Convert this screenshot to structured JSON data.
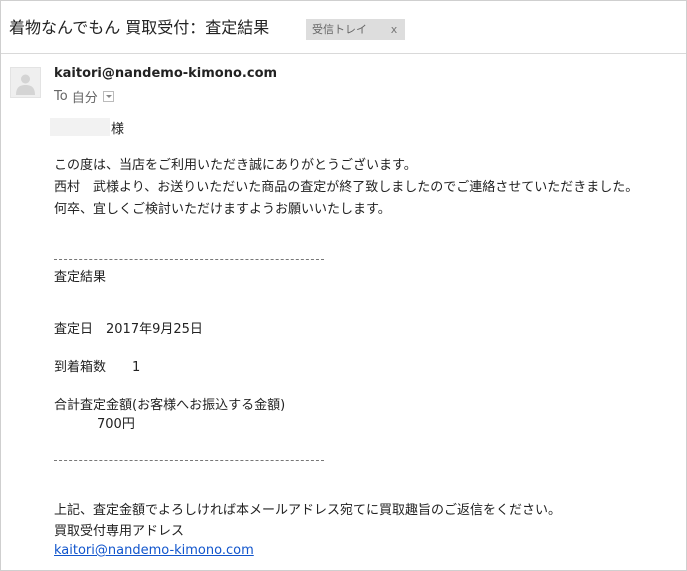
{
  "header": {
    "subject": "着物なんでもん 買取受付：査定結果",
    "label": "受信トレイ",
    "label_close": "x"
  },
  "sender": {
    "email": "kaitori@nandemo-kimono.com",
    "to_label": "To",
    "to_value": "自分"
  },
  "body": {
    "salutation_suffix": "様",
    "para1": [
      "この度は、当店をご利用いただき誠にありがとうございます。",
      "西村　武様より、お送りいただいた商品の査定が終了致しましたのでご連絡させていただきました。",
      "何卒、宜しくご検討いただけますようお願いいたします。"
    ],
    "result_title": "査定結果",
    "date_line": "査定日　2017年9月25日",
    "boxes_line": "到着箱数　　1",
    "total_label": "合計査定金額(お客様へお振込する金額)",
    "total_value": "700円",
    "closing1": "上記、査定金額でよろしければ本メールアドレス宛てに買取趣旨のご返信をください。",
    "closing2": "買取受付専用アドレス",
    "closing_link": "kaitori@nandemo-kimono.com"
  }
}
